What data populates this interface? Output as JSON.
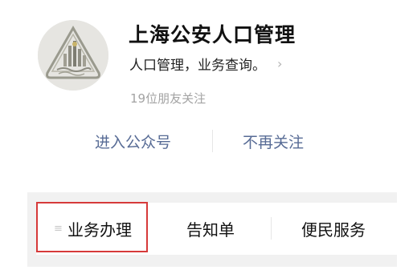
{
  "account": {
    "name": "上海公安人口管理",
    "description": "人口管理，业务查询。",
    "chevron": "›",
    "followers": "19位朋友关注",
    "avatar_icon": "shanghai-police-emblem-icon"
  },
  "actions": {
    "enter_label": "进入公众号",
    "unfollow_label": "不再关注"
  },
  "menu": {
    "items": [
      {
        "label": "业务办理",
        "icon": "≡",
        "icon_name": "menu-list-icon",
        "highlighted": true
      },
      {
        "label": "告知单"
      },
      {
        "label": "便民服务"
      }
    ]
  },
  "colors": {
    "link": "#576b95",
    "highlight": "#d63a3a",
    "menu_background": "#f1f1f1"
  }
}
